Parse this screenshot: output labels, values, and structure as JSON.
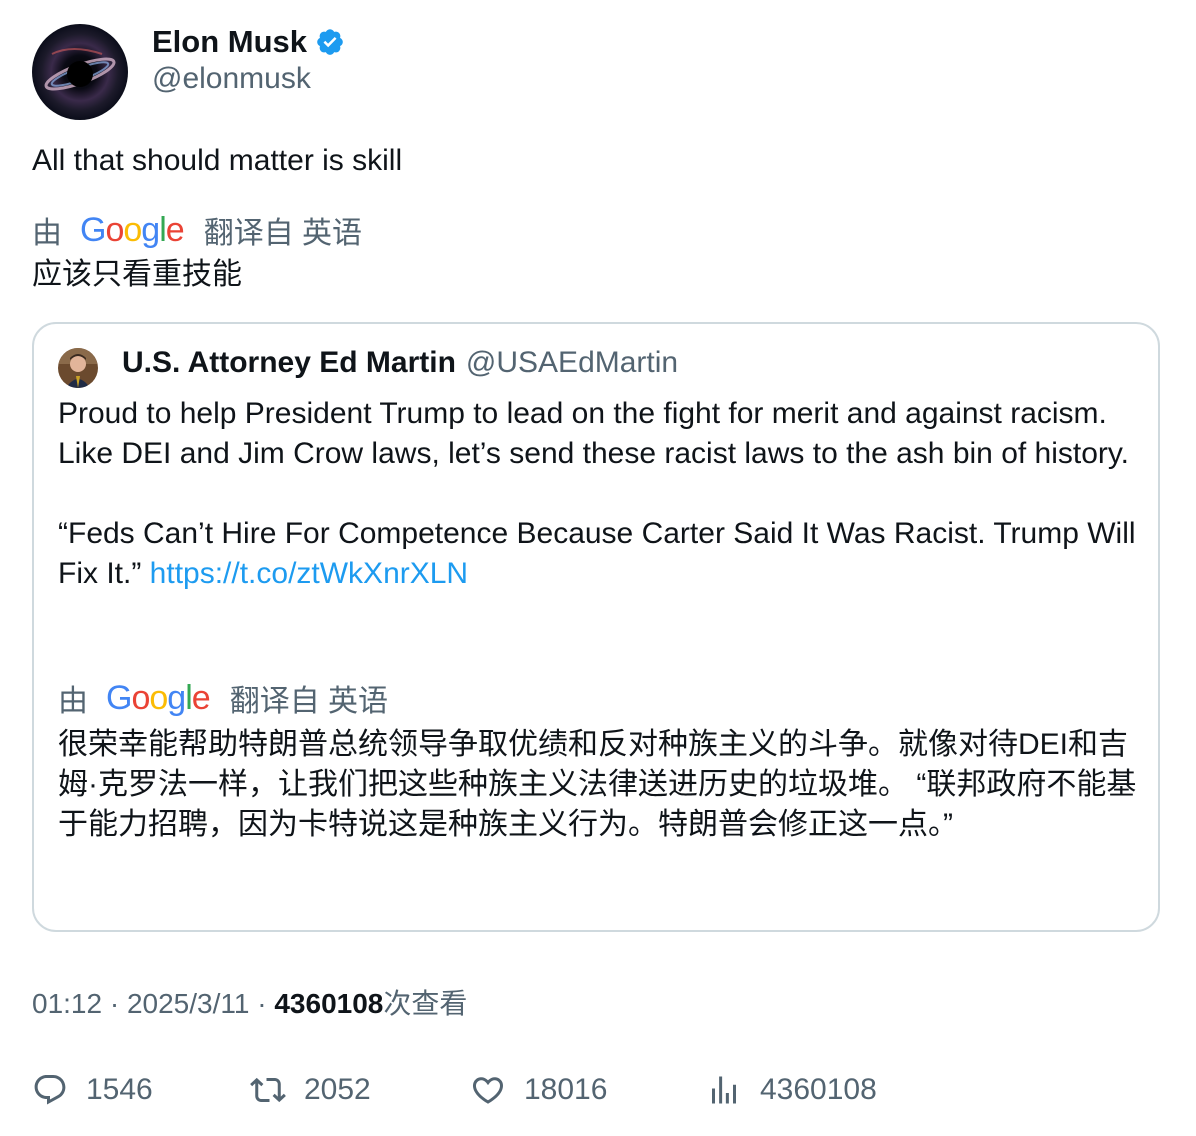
{
  "author": {
    "name": "Elon Musk",
    "handle": "@elonmusk",
    "verified": true
  },
  "tweet": {
    "text": "All that should matter is skill",
    "translate_by": "由",
    "translate_source": "翻译自 英语",
    "translated_text": "应该只看重技能"
  },
  "quoted_tweet": {
    "name": "U.S. Attorney Ed Martin",
    "handle": "@USAEdMartin",
    "paragraph1": "Proud to help President Trump to lead on the fight for merit and against racism. Like DEI and Jim Crow laws, let’s send these racist laws to the ash bin of history.",
    "paragraph2_text": "“Feds Can’t Hire For Competence Because  Carter Said It Was Racist. Trump Will Fix It.”",
    "link": "https://t.co/ztWkXnrXLN",
    "translate_by": "由",
    "translate_source": "翻译自 英语",
    "translated_text": "很荣幸能帮助特朗普总统领导争取优绩和反对种族主义的斗争。就像对待DEI和吉姆·克罗法一样，让我们把这些种族主义法律送进历史的垃圾堆。 “联邦政府不能基于能力招聘，因为卡特说这是种族主义行为。特朗普会修正这一点。”"
  },
  "meta": {
    "time": "01:12",
    "separator": " · ",
    "date": "2025/3/11",
    "views_count": "4360108",
    "views_label": "次查看"
  },
  "actions": {
    "replies": "1546",
    "retweets": "2052",
    "likes": "18016",
    "views": "4360108"
  },
  "colors": {
    "link": "#1d9bf0",
    "secondary_text": "#536471",
    "verified_badge": "#1d9bf0"
  }
}
